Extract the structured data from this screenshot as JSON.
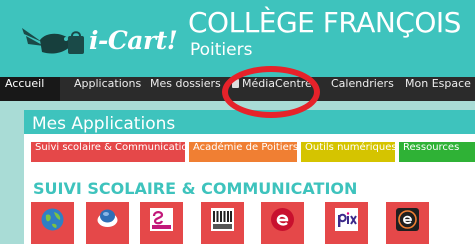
{
  "header": {
    "logo_text": "i-Cart!",
    "school_name": "COLLÈGE FRANÇOIS",
    "school_city": "Poitiers"
  },
  "nav": {
    "items": [
      {
        "label": "Accueil",
        "active": true
      },
      {
        "label": "Applications"
      },
      {
        "label": "Mes dossiers"
      },
      {
        "label": "MédiaCentre",
        "icon": "book-icon"
      },
      {
        "label": "Calendriers"
      },
      {
        "label": "Mon Espace"
      }
    ]
  },
  "panel": {
    "title": "Mes Applications",
    "tabs": [
      {
        "label": "Suivi scolaire & Communication",
        "color": "#e54849"
      },
      {
        "label": "Académie de Poitiers",
        "color": "#f07f33"
      },
      {
        "label": "Outils numériques",
        "color": "#d5c400"
      },
      {
        "label": "Ressources",
        "color": "#2fb236"
      }
    ],
    "section_title": "SUIVI SCOLAIRE & COMMUNICATION",
    "apps": [
      {
        "icon": "globe-icon",
        "label": ""
      },
      {
        "icon": "chat-bubble-icon",
        "label": ""
      },
      {
        "icon": "scol-logo-icon",
        "label": ""
      },
      {
        "icon": "folio-logo-icon",
        "label": ""
      },
      {
        "icon": "e-letter-icon",
        "label": ""
      },
      {
        "icon": "pix-logo-icon",
        "label": ""
      },
      {
        "icon": "e-badge-icon",
        "label": ""
      }
    ]
  },
  "colors": {
    "brand": "#3ec3bd",
    "nav_bg": "#2b2b2b",
    "tile": "#e54849",
    "highlight": "#e6222a"
  }
}
